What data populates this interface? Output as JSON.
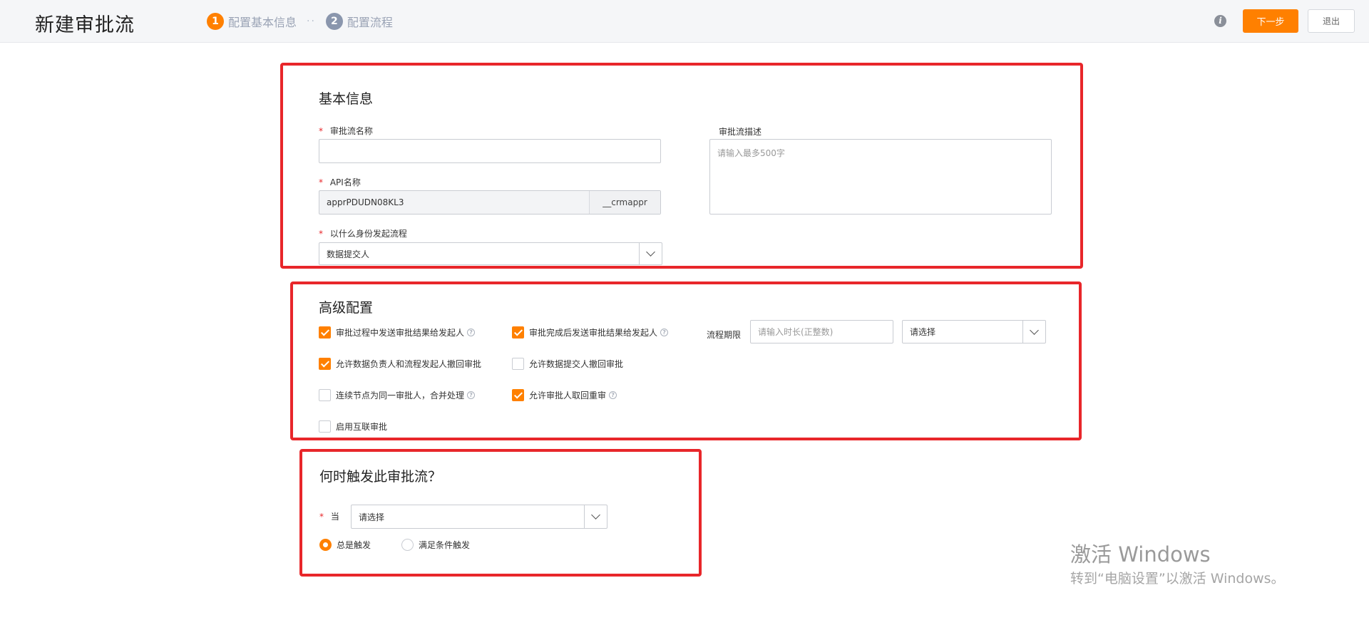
{
  "header": {
    "title": "新建审批流",
    "steps": [
      {
        "num": "1",
        "label": "配置基本信息"
      },
      {
        "num": "2",
        "label": "配置流程"
      }
    ],
    "step_separator": "··",
    "info_icon": "info-icon",
    "next_label": "下一步",
    "exit_label": "退出",
    "accent_color": "#ff8000"
  },
  "basic": {
    "title": "基本信息",
    "required_mark": "*",
    "name_label": "审批流名称",
    "name_value": "",
    "api_label": "API名称",
    "api_value": "apprPDUDN08KL3",
    "api_suffix": "__crmappr",
    "identity_label": "以什么身份发起流程",
    "identity_value": "数据提交人",
    "desc_label": "审批流描述",
    "desc_placeholder": "请输入最多500字"
  },
  "advanced": {
    "title": "高级配置",
    "options": [
      {
        "label": "审批过程中发送审批结果给发起人",
        "checked": true,
        "help": true
      },
      {
        "label": "审批完成后发送审批结果给发起人",
        "checked": true,
        "help": true
      },
      {
        "label": "允许数据负责人和流程发起人撤回审批",
        "checked": true,
        "help": false
      },
      {
        "label": "允许数据提交人撤回审批",
        "checked": false,
        "help": false
      },
      {
        "label": "连续节点为同一审批人，合并处理",
        "checked": false,
        "help": true
      },
      {
        "label": "允许审批人取回重审",
        "checked": true,
        "help": true
      },
      {
        "label": "启用互联审批",
        "checked": false,
        "help": false
      }
    ],
    "deadline_label": "流程期限",
    "deadline_placeholder": "请输入时长(正整数)",
    "unit_value": "请选择"
  },
  "trigger": {
    "title": "何时触发此审批流？",
    "when_label": "当",
    "when_value": "请选择",
    "radio_always": "总是触发",
    "radio_condition": "满足条件触发"
  },
  "watermark": {
    "title": "激活 Windows",
    "subtitle": "转到“电脑设置”以激活 Windows。"
  }
}
